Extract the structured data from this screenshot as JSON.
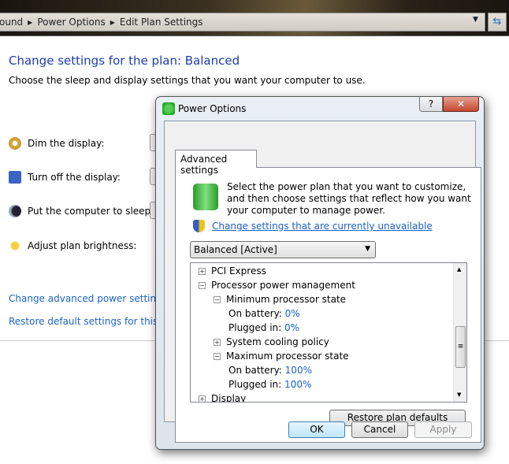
{
  "explorer": {
    "breadcrumb": [
      "ound",
      "Power Options",
      "Edit Plan Settings"
    ],
    "title": "Change settings for the plan: Balanced",
    "subtitle": "Choose the sleep and display settings that you want your computer to use.",
    "settings": [
      {
        "label": "Dim the display:",
        "icon": "dim-display-icon"
      },
      {
        "label": "Turn off the display:",
        "icon": "monitor-clock-icon"
      },
      {
        "label": "Put the computer to sleep:",
        "icon": "moon-icon"
      },
      {
        "label": "Adjust plan brightness:",
        "icon": "sun-icon"
      }
    ],
    "links": [
      "Change advanced power settings",
      "Restore default settings for this plan"
    ]
  },
  "dialog": {
    "title": "Power Options",
    "help": "?",
    "close": "✕",
    "tab": "Advanced settings",
    "description": "Select the power plan that you want to customize, and then choose settings that reflect how you want your computer to manage power.",
    "uac_link": "Change settings that are currently unavailable",
    "plan": "Balanced [Active]",
    "tree": [
      {
        "label": "PCI Express",
        "expander": "+",
        "level": 0
      },
      {
        "label": "Processor power management",
        "expander": "−",
        "level": 0
      },
      {
        "label": "Minimum processor state",
        "expander": "−",
        "level": 1
      },
      {
        "label": "On battery:",
        "value": "0%",
        "level": 2
      },
      {
        "label": "Plugged in:",
        "value": "0%",
        "level": 2
      },
      {
        "label": "System cooling policy",
        "expander": "+",
        "level": 1
      },
      {
        "label": "Maximum processor state",
        "expander": "−",
        "level": 1
      },
      {
        "label": "On battery:",
        "value": "100%",
        "level": 2
      },
      {
        "label": "Plugged in:",
        "value": "100%",
        "level": 2
      },
      {
        "label": "Display",
        "expander": "+",
        "level": 0
      }
    ],
    "restore": "Restore plan defaults",
    "ok": "OK",
    "cancel": "Cancel",
    "apply": "Apply"
  }
}
